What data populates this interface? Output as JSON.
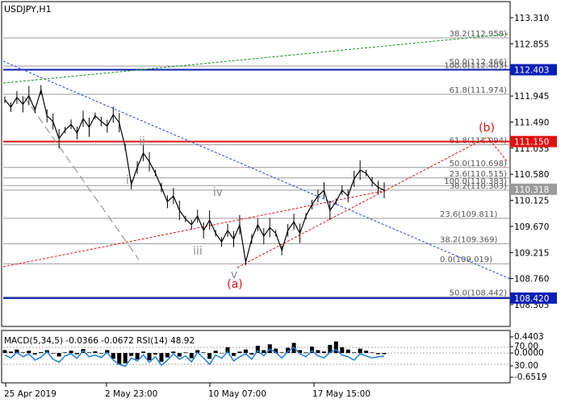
{
  "chart_data": {
    "type": "line",
    "title": "USDJPY,H1",
    "price_axis": {
      "ticks": [
        113.31,
        112.855,
        112.403,
        111.945,
        111.49,
        111.035,
        110.58,
        110.125,
        109.67,
        109.215,
        108.76,
        108.305
      ],
      "tick_labels": [
        "113.310",
        "112.855",
        "111.945",
        "111.490",
        "111.035",
        "110.580",
        "110.125",
        "109.670",
        "109.215",
        "108.760",
        "108.305"
      ],
      "ylim": [
        108.22,
        113.5
      ]
    },
    "price_tags": [
      {
        "label": "112.403",
        "value": 112.403,
        "color": "#0a1fb5"
      },
      {
        "label": "111.150",
        "value": 111.15,
        "color": "#e01010"
      },
      {
        "label": "110.318",
        "value": 110.318,
        "color": "#9a9a9a"
      },
      {
        "label": "108.420",
        "value": 108.42,
        "color": "#0a1fb5"
      }
    ],
    "levels": [
      {
        "label": "38.2(112.958)",
        "value": 112.958,
        "anchor": "right"
      },
      {
        "label": "50.0(112.466)",
        "value": 112.466,
        "anchor": "right"
      },
      {
        "label": "100.0(112.403)",
        "value": 112.403,
        "anchor": "right"
      },
      {
        "label": "61.8(111.974)",
        "value": 111.974,
        "anchor": "right"
      },
      {
        "label": "61.8(111.094)",
        "value": 111.094,
        "anchor": "right"
      },
      {
        "label": "50.0(110.698)",
        "value": 110.698,
        "anchor": "right"
      },
      {
        "label": "23.6(110.515)",
        "value": 110.515,
        "anchor": "right"
      },
      {
        "label": "100.0(110.383)",
        "value": 110.383,
        "anchor": "right"
      },
      {
        "label": "38.2(110.303)",
        "value": 110.303,
        "anchor": "right"
      },
      {
        "label": "23.6(109.811)",
        "value": 109.811,
        "anchor": "mid"
      },
      {
        "label": "38.2(109.369)",
        "value": 109.369,
        "anchor": "mid"
      },
      {
        "label": "0.0(109.019)",
        "value": 109.019,
        "anchor": "mid"
      },
      {
        "label": "50.0(108.442)",
        "value": 108.442,
        "anchor": "right"
      }
    ],
    "horizontal_lines": [
      {
        "value": 112.403,
        "color": "#0a1fb5",
        "weight": "thick"
      },
      {
        "value": 111.15,
        "color": "#e01010",
        "weight": "thick"
      },
      {
        "value": 108.42,
        "color": "#0a1fb5",
        "weight": "thick"
      }
    ],
    "wave_labels": [
      {
        "text": "ii",
        "color": "#8c8c8c"
      },
      {
        "text": "i",
        "color": "#8c8c8c"
      },
      {
        "text": "iv",
        "color": "#8c8c8c"
      },
      {
        "text": "iii",
        "color": "#8c8c8c"
      },
      {
        "text": "v",
        "color": "#8c8c8c"
      },
      {
        "text": "(a)",
        "color": "#e01010"
      },
      {
        "text": "(b)",
        "color": "#e01010"
      }
    ],
    "x_axis_labels": [
      "25 Apr 2019",
      "2 May 23:00",
      "10 May 07:00",
      "17 May 15:00"
    ],
    "price_series": [
      111.88,
      111.75,
      111.92,
      111.8,
      111.95,
      111.7,
      112.05,
      111.6,
      111.5,
      111.2,
      111.35,
      111.45,
      111.3,
      111.55,
      111.4,
      111.6,
      111.5,
      111.42,
      111.62,
      111.48,
      111.05,
      110.4,
      110.7,
      110.95,
      110.8,
      110.6,
      110.35,
      110.1,
      110.2,
      109.95,
      109.8,
      109.7,
      109.85,
      109.6,
      109.78,
      109.55,
      109.4,
      109.6,
      109.45,
      109.7,
      109.05,
      109.45,
      109.7,
      109.5,
      109.65,
      109.55,
      109.25,
      109.6,
      109.75,
      109.55,
      109.85,
      110.05,
      110.2,
      110.3,
      109.95,
      110.1,
      110.3,
      110.2,
      110.5,
      110.65,
      110.6,
      110.45,
      110.35,
      110.3
    ],
    "indicator": {
      "label": "MACD(5,34,5) -0.0366 -0.0672 RSI(14) 48.92",
      "ticks": [
        "0.4403",
        "70.00",
        "0.0000",
        "30.00",
        "-0.6519"
      ],
      "rsi_series": [
        52,
        45,
        58,
        48,
        55,
        40,
        47,
        60,
        42,
        35,
        50,
        55,
        44,
        62,
        48,
        52,
        46,
        58,
        40,
        30,
        25,
        45,
        38,
        52,
        35,
        48,
        28,
        40,
        55,
        42,
        50,
        36,
        58,
        45,
        30,
        52,
        44,
        60,
        38,
        48,
        55,
        42,
        62,
        50,
        66,
        58,
        45,
        60,
        70,
        55,
        48,
        62,
        50,
        45,
        58,
        65,
        52,
        48,
        40,
        55,
        50,
        45,
        48,
        49
      ],
      "macd_series": [
        0.1,
        0.05,
        0.12,
        0.02,
        0.08,
        -0.05,
        0.03,
        0.1,
        -0.02,
        -0.12,
        0.02,
        0.08,
        -0.04,
        0.14,
        0.02,
        0.06,
        -0.02,
        0.1,
        -0.2,
        -0.4,
        -0.35,
        -0.1,
        -0.22,
        0.05,
        -0.25,
        -0.05,
        -0.3,
        -0.15,
        0.05,
        -0.12,
        0.02,
        -0.18,
        0.1,
        0.02,
        -0.2,
        0.08,
        0.0,
        0.2,
        -0.1,
        0.05,
        0.12,
        -0.05,
        0.25,
        0.1,
        0.3,
        0.15,
        0.02,
        0.18,
        0.35,
        0.1,
        0.02,
        0.22,
        0.1,
        0.05,
        0.28,
        0.4,
        0.2,
        0.12,
        0.02,
        0.15,
        0.08,
        0.02,
        -0.04,
        -0.04
      ]
    }
  }
}
